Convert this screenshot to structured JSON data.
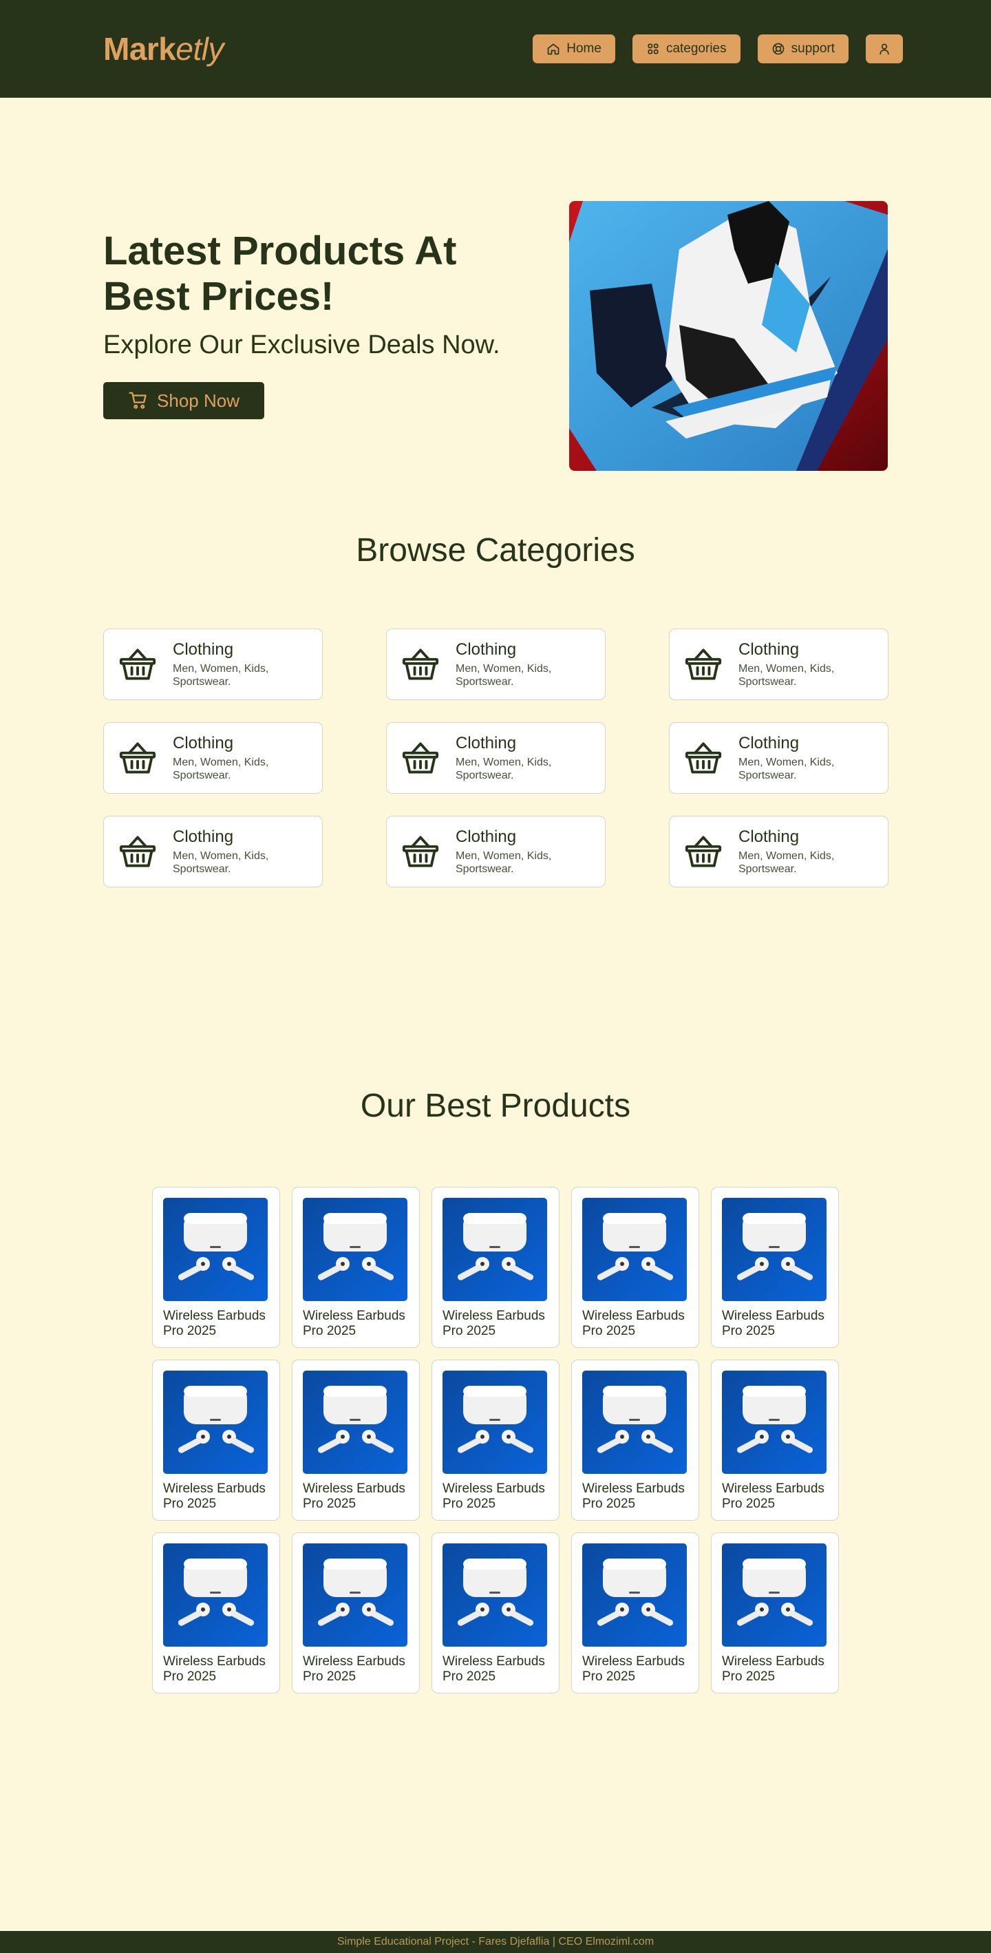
{
  "header": {
    "logo_bold": "Mark",
    "logo_italic": "etly",
    "nav": [
      {
        "label": "Home",
        "icon": "home-icon"
      },
      {
        "label": "categories",
        "icon": "grid-icon"
      },
      {
        "label": "support",
        "icon": "support-icon"
      },
      {
        "label": "",
        "icon": "user-icon"
      }
    ]
  },
  "hero": {
    "title": "Latest Products At Best Prices!",
    "subtitle": "Explore Our Exclusive Deals Now.",
    "button_label": "Shop Now",
    "image_icon": "sneaker-photo"
  },
  "categories": {
    "title": "Browse Categories",
    "items": [
      {
        "name": "Clothing",
        "description": "Men, Women, Kids, Sportswear."
      },
      {
        "name": "Clothing",
        "description": "Men, Women, Kids, Sportswear."
      },
      {
        "name": "Clothing",
        "description": "Men, Women, Kids, Sportswear."
      },
      {
        "name": "Clothing",
        "description": "Men, Women, Kids, Sportswear."
      },
      {
        "name": "Clothing",
        "description": "Men, Women, Kids, Sportswear."
      },
      {
        "name": "Clothing",
        "description": "Men, Women, Kids, Sportswear."
      },
      {
        "name": "Clothing",
        "description": "Men, Women, Kids, Sportswear."
      },
      {
        "name": "Clothing",
        "description": "Men, Women, Kids, Sportswear."
      },
      {
        "name": "Clothing",
        "description": "Men, Women, Kids, Sportswear."
      }
    ]
  },
  "products": {
    "title": "Our Best Products",
    "items": [
      {
        "name": "Wireless Earbuds Pro 2025"
      },
      {
        "name": "Wireless Earbuds Pro 2025"
      },
      {
        "name": "Wireless Earbuds Pro 2025"
      },
      {
        "name": "Wireless Earbuds Pro 2025"
      },
      {
        "name": "Wireless Earbuds Pro 2025"
      },
      {
        "name": "Wireless Earbuds Pro 2025"
      },
      {
        "name": "Wireless Earbuds Pro 2025"
      },
      {
        "name": "Wireless Earbuds Pro 2025"
      },
      {
        "name": "Wireless Earbuds Pro 2025"
      },
      {
        "name": "Wireless Earbuds Pro 2025"
      },
      {
        "name": "Wireless Earbuds Pro 2025"
      },
      {
        "name": "Wireless Earbuds Pro 2025"
      },
      {
        "name": "Wireless Earbuds Pro 2025"
      },
      {
        "name": "Wireless Earbuds Pro 2025"
      },
      {
        "name": "Wireless Earbuds Pro 2025"
      }
    ]
  },
  "footer": {
    "text": "Simple Educational Project - Fares Djefaflia | CEO Elmoziml.com"
  },
  "colors": {
    "header_bg": "#283419",
    "accent": "#dfa15f",
    "page_bg": "#fdf7dc"
  }
}
